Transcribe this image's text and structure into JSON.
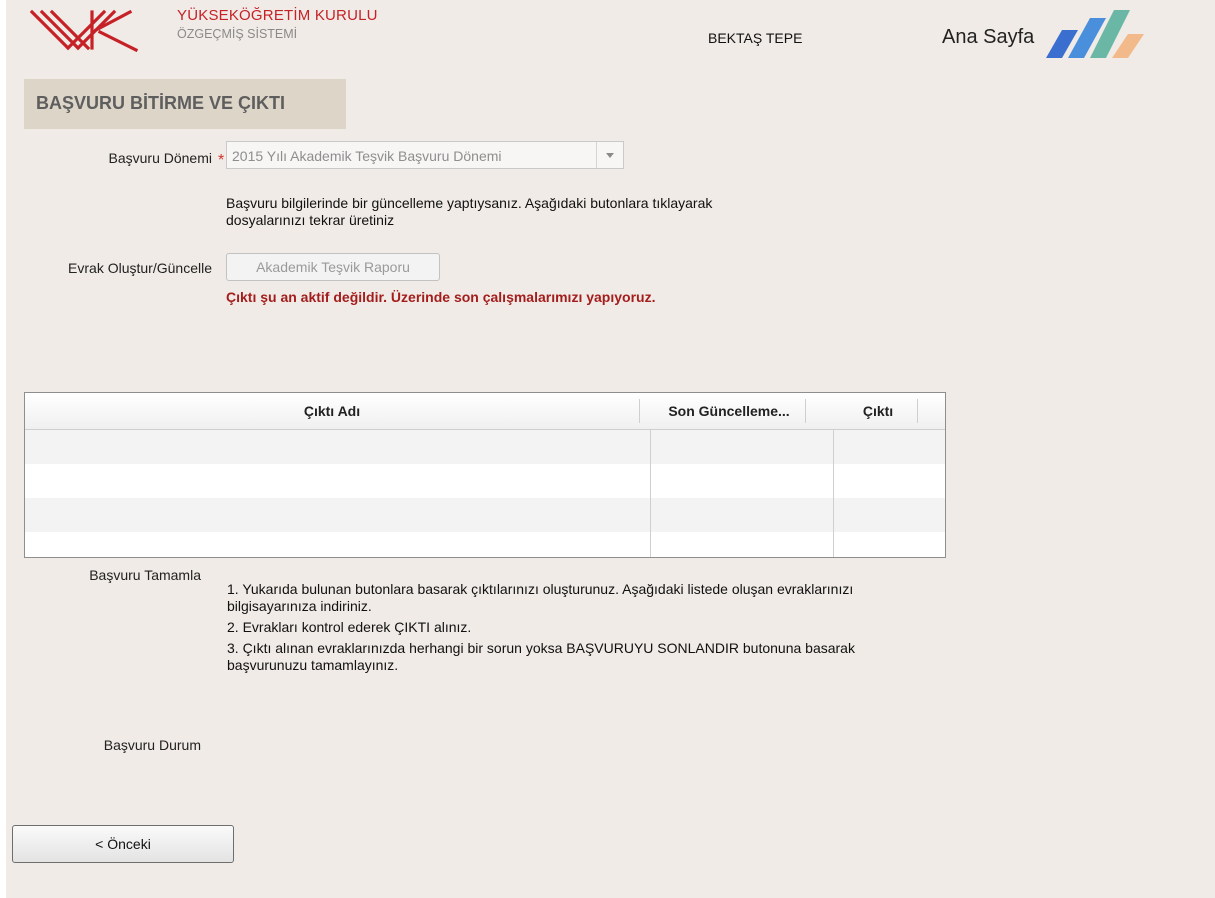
{
  "header": {
    "org_title": "YÜKSEKÖĞRETİM KURULU",
    "org_subtitle": "ÖZGEÇMİŞ SİSTEMİ",
    "user_name": "BEKTAŞ TEPE",
    "home_label": "Ana Sayfa",
    "brand_color": "#c62127",
    "home_logo_colors": [
      "#3a6fd0",
      "#4aa3df",
      "#6ab7a6",
      "#f2b98a"
    ]
  },
  "section": {
    "title": "BAŞVURU BİTİRME VE ÇIKTI"
  },
  "form": {
    "period_label": "Başvuru Dönemi",
    "required_mark": "*",
    "period_value": "2015 Yılı Akademik Teşvik Başvuru Dönemi",
    "info_text": "Başvuru bilgilerinde bir güncelleme yaptıysanız. Aşağıdaki butonlara tıklayarak dosyalarınızı tekrar üretiniz",
    "document_label": "Evrak Oluştur/Güncelle",
    "report_button": "Akademik Teşvik Raporu",
    "warning": "Çıktı şu an aktif değildir. Üzerinde son çalışmalarımızı yapıyoruz."
  },
  "grid": {
    "columns": [
      "Çıktı Adı",
      "Son Güncelleme...",
      "Çıktı"
    ],
    "rows": []
  },
  "completion": {
    "label": "Başvuru Tamamla",
    "steps": [
      "1. Yukarıda bulunan butonlara basarak çıktılarınızı oluşturunuz. Aşağıdaki listede oluşan evraklarınızı bilgisayarınıza indiriniz.",
      "2. Evrakları kontrol ederek ÇIKTI alınız.",
      "3. Çıktı alınan evraklarınızda herhangi bir sorun yoksa BAŞVURUYU SONLANDIR butonuna basarak başvurunuzu tamamlayınız."
    ]
  },
  "status": {
    "label": "Başvuru Durum"
  },
  "navigation": {
    "prev_button": "< Önceki"
  }
}
